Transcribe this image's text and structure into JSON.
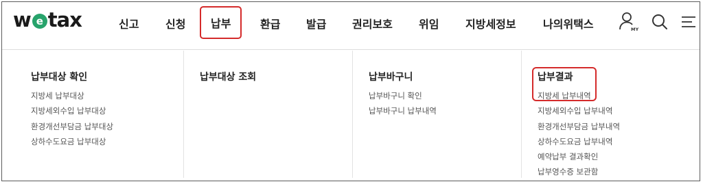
{
  "logo": {
    "pre": "w",
    "mid": "e",
    "post": "tax"
  },
  "nav": {
    "items": [
      "신고",
      "신청",
      "납부",
      "환급",
      "발급",
      "권리보호",
      "위임",
      "지방세정보",
      "나의위택스"
    ]
  },
  "icons": {
    "my": "MY",
    "my_name": "my-account-icon",
    "search_name": "search-icon",
    "menu_name": "menu-icon"
  },
  "menu": {
    "columns": [
      {
        "title": "납부대상 확인",
        "items": [
          "지방세 납부대상",
          "지방세외수입 납부대상",
          "환경개선부담금 납부대상",
          "상하수도요금 납부대상"
        ]
      },
      {
        "title": "납부대상 조회",
        "items": []
      },
      {
        "title": "납부바구니",
        "items": [
          "납부바구니 확인",
          "납부바구니 납부내역"
        ]
      },
      {
        "title": "납부결과",
        "items": [
          "지방세 납부내역",
          "지방세외수입 납부내역",
          "환경개선부담금 납부내역",
          "상하수도요금 납부내역",
          "예약납부 결과확인",
          "납부영수증 보관함"
        ]
      }
    ]
  },
  "colors": {
    "highlight": "#d42a2a",
    "logo_green": "#27a36b"
  }
}
